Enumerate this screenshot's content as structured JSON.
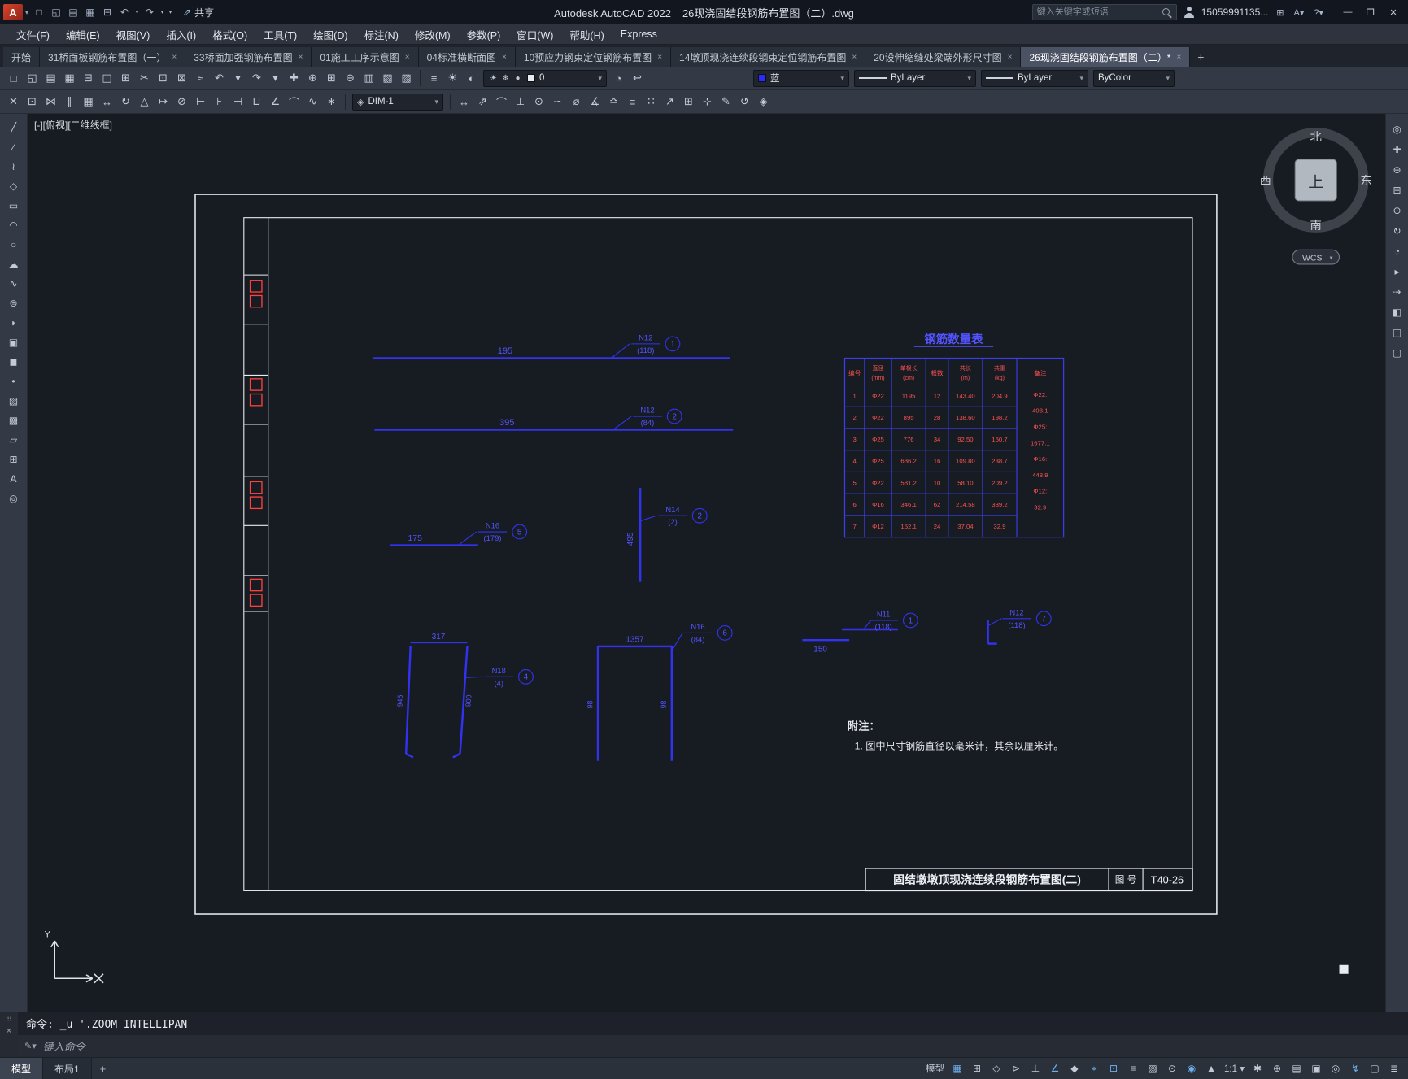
{
  "titlebar": {
    "product": "Autodesk AutoCAD 2022",
    "filename": "26现浇固结段钢筋布置图（二）.dwg",
    "share_label": "共享",
    "search_placeholder": "键入关键字或短语",
    "user_id": "15059991135...",
    "window": {
      "minimize": "—",
      "maximize": "❐",
      "close": "✕"
    },
    "qat_icons": [
      {
        "name": "qat-new-icon",
        "glyph": "□"
      },
      {
        "name": "qat-open-icon",
        "glyph": "◱"
      },
      {
        "name": "qat-save-icon",
        "glyph": "▤"
      },
      {
        "name": "qat-saveas-icon",
        "glyph": "▦"
      },
      {
        "name": "qat-plot-icon",
        "glyph": "⊟"
      },
      {
        "name": "qat-undo-icon",
        "glyph": "↶"
      },
      {
        "name": "qat-undo-arrow-icon",
        "glyph": "▾",
        "small": true
      },
      {
        "name": "qat-redo-icon",
        "glyph": "↷"
      },
      {
        "name": "qat-redo-arrow-icon",
        "glyph": "▾",
        "small": true
      },
      {
        "name": "qat-customize-icon",
        "glyph": "▾",
        "small": true
      }
    ]
  },
  "menubar": {
    "items": [
      {
        "label": "文件(F)"
      },
      {
        "label": "编辑(E)"
      },
      {
        "label": "视图(V)"
      },
      {
        "label": "插入(I)"
      },
      {
        "label": "格式(O)"
      },
      {
        "label": "工具(T)"
      },
      {
        "label": "绘图(D)"
      },
      {
        "label": "标注(N)"
      },
      {
        "label": "修改(M)"
      },
      {
        "label": "参数(P)"
      },
      {
        "label": "窗口(W)"
      },
      {
        "label": "帮助(H)"
      },
      {
        "label": "Express"
      }
    ]
  },
  "tabs": {
    "items": [
      {
        "label": "开始",
        "closable": false,
        "active": false
      },
      {
        "label": "31桥面板钢筋布置图（一）",
        "closable": true,
        "active": false
      },
      {
        "label": "33桥面加强钢筋布置图",
        "closable": true,
        "active": false
      },
      {
        "label": "01施工工序示意图",
        "closable": true,
        "active": false
      },
      {
        "label": "04标准横断面图",
        "closable": true,
        "active": false
      },
      {
        "label": "10预应力钢束定位钢筋布置图",
        "closable": true,
        "active": false
      },
      {
        "label": "14墩顶现浇连续段钢束定位钢筋布置图",
        "closable": true,
        "active": false
      },
      {
        "label": "20设伸缩缝处梁端外形尺寸图",
        "closable": true,
        "active": false
      },
      {
        "label": "26现浇固结段钢筋布置图（二）*",
        "closable": true,
        "active": true
      }
    ],
    "new_tab_label": "+"
  },
  "toolbar1": {
    "icons": [
      {
        "name": "qnew-icon",
        "glyph": "□"
      },
      {
        "name": "open-icon",
        "glyph": "◱"
      },
      {
        "name": "save-icon",
        "glyph": "▤"
      },
      {
        "name": "saveas-icon",
        "glyph": "▦"
      },
      {
        "name": "plot-icon",
        "glyph": "⊟"
      },
      {
        "name": "plot-preview-icon",
        "glyph": "◫"
      },
      {
        "name": "publish-icon",
        "glyph": "⊞"
      },
      {
        "name": "cut-icon",
        "glyph": "✂"
      },
      {
        "name": "copy-clip-icon",
        "glyph": "⊡"
      },
      {
        "name": "paste-icon",
        "glyph": "⊠"
      },
      {
        "name": "match-properties-icon",
        "glyph": "≈"
      },
      {
        "name": "undo-icon",
        "glyph": "↶"
      },
      {
        "name": "undo-list-icon",
        "glyph": "▾",
        "small": true
      },
      {
        "name": "redo-icon",
        "glyph": "↷"
      },
      {
        "name": "redo-list-icon",
        "glyph": "▾",
        "small": true
      },
      {
        "name": "pan-icon",
        "glyph": "✚"
      },
      {
        "name": "zoom-realtime-icon",
        "glyph": "⊕"
      },
      {
        "name": "zoom-window-icon",
        "glyph": "⊞"
      },
      {
        "name": "zoom-previous-icon",
        "glyph": "⊖"
      },
      {
        "name": "properties-icon",
        "glyph": "▥"
      },
      {
        "name": "designcenter-icon",
        "glyph": "▧"
      },
      {
        "name": "tool-palettes-icon",
        "glyph": "▨"
      }
    ],
    "layer_group_icons": [
      {
        "name": "layer-properties-icon",
        "glyph": "≡"
      },
      {
        "name": "layer-states-icon",
        "glyph": "☀"
      },
      {
        "name": "layer-isolate-icon",
        "glyph": "◐"
      }
    ],
    "layer_dropdown": {
      "value": "0",
      "icons": [
        {
          "name": "layer-on-icon",
          "glyph": "☀"
        },
        {
          "name": "layer-freeze-icon",
          "glyph": "❄"
        },
        {
          "name": "layer-lock-icon",
          "glyph": "●"
        }
      ]
    },
    "layer_extra_icons": [
      {
        "name": "make-current-layer-icon",
        "glyph": "◔"
      },
      {
        "name": "layer-previous-icon",
        "glyph": "↩"
      }
    ],
    "color_dropdown": {
      "value": "蓝"
    },
    "linetype_dropdown": {
      "value": "ByLayer"
    },
    "lineweight_dropdown": {
      "value": "ByLayer"
    },
    "plotstyle_dropdown": {
      "value": "ByColor"
    }
  },
  "toolbar2": {
    "icons_left": [
      {
        "name": "erase-icon",
        "glyph": "✕"
      },
      {
        "name": "copy-icon",
        "glyph": "⊡"
      },
      {
        "name": "mirror-icon",
        "glyph": "⋈"
      },
      {
        "name": "offset-icon",
        "glyph": "∥"
      },
      {
        "name": "array-icon",
        "glyph": "▦"
      },
      {
        "name": "move-icon",
        "glyph": "↔"
      },
      {
        "name": "rotate-icon",
        "glyph": "↻"
      },
      {
        "name": "scale-icon",
        "glyph": "△"
      },
      {
        "name": "stretch-icon",
        "glyph": "↦"
      },
      {
        "name": "trim-icon",
        "glyph": "⊘"
      },
      {
        "name": "extend-icon",
        "glyph": "⊢"
      },
      {
        "name": "break-at-point-icon",
        "glyph": "⊦"
      },
      {
        "name": "break-icon",
        "glyph": "⊣"
      },
      {
        "name": "join-icon",
        "glyph": "⊔"
      },
      {
        "name": "chamfer-icon",
        "glyph": "∠"
      },
      {
        "name": "fillet-icon",
        "glyph": "⌒"
      },
      {
        "name": "blend-icon",
        "glyph": "∿"
      },
      {
        "name": "explode-icon",
        "glyph": "∗"
      }
    ],
    "dimstyle_dropdown": {
      "value": "DIM-1"
    },
    "icons_right": [
      {
        "name": "linear-dimension-icon",
        "glyph": "↔"
      },
      {
        "name": "aligned-dimension-icon",
        "glyph": "⇗"
      },
      {
        "name": "arc-length-icon",
        "glyph": "⌒"
      },
      {
        "name": "ordinate-icon",
        "glyph": "⊥"
      },
      {
        "name": "radius-dimension-icon",
        "glyph": "⊙"
      },
      {
        "name": "jogged-icon",
        "glyph": "∽"
      },
      {
        "name": "diameter-dimension-icon",
        "glyph": "⌀"
      },
      {
        "name": "angular-dimension-icon",
        "glyph": "∡"
      },
      {
        "name": "quick-dimension-icon",
        "glyph": "≏"
      },
      {
        "name": "baseline-dimension-icon",
        "glyph": "≡"
      },
      {
        "name": "continue-dimension-icon",
        "glyph": "∷"
      },
      {
        "name": "leader-icon",
        "glyph": "↗"
      },
      {
        "name": "tolerance-icon",
        "glyph": "⊞"
      },
      {
        "name": "center-mark-icon",
        "glyph": "⊹"
      },
      {
        "name": "dimension-edit-icon",
        "glyph": "✎"
      },
      {
        "name": "dimension-update-icon",
        "glyph": "↺"
      },
      {
        "name": "dimension-style-icon",
        "glyph": "◈"
      }
    ]
  },
  "left_toolbar": {
    "icons": [
      {
        "name": "line-icon",
        "glyph": "╱"
      },
      {
        "name": "construction-line-icon",
        "glyph": "∕"
      },
      {
        "name": "polyline-icon",
        "glyph": "≀"
      },
      {
        "name": "polygon-icon",
        "glyph": "◇"
      },
      {
        "name": "rectangle-icon",
        "glyph": "▭"
      },
      {
        "name": "arc-icon",
        "glyph": "◠"
      },
      {
        "name": "circle-icon",
        "glyph": "○"
      },
      {
        "name": "revision-cloud-icon",
        "glyph": "☁"
      },
      {
        "name": "spline-icon",
        "glyph": "∿"
      },
      {
        "name": "ellipse-icon",
        "glyph": "⊜"
      },
      {
        "name": "ellipse-arc-icon",
        "glyph": "◗"
      },
      {
        "name": "insert-block-icon",
        "glyph": "▣"
      },
      {
        "name": "make-block-icon",
        "glyph": "◼"
      },
      {
        "name": "point-icon",
        "glyph": "•"
      },
      {
        "name": "hatch-icon",
        "glyph": "▨"
      },
      {
        "name": "gradient-icon",
        "glyph": "▩"
      },
      {
        "name": "region-icon",
        "glyph": "▱"
      },
      {
        "name": "table-icon",
        "glyph": "⊞"
      },
      {
        "name": "multiline-text-icon",
        "glyph": "A"
      },
      {
        "name": "add-selected-icon",
        "glyph": "◎"
      }
    ]
  },
  "right_toolbar": {
    "icons": [
      {
        "name": "navigation-wheel-icon",
        "glyph": "◎"
      },
      {
        "name": "pan-icon",
        "glyph": "✚"
      },
      {
        "name": "zoom-extents-icon",
        "glyph": "⊕"
      },
      {
        "name": "zoom-window-icon",
        "glyph": "⊞"
      },
      {
        "name": "zoom-realtime-icon",
        "glyph": "⊙"
      },
      {
        "name": "orbit-icon",
        "glyph": "↻"
      },
      {
        "name": "free-orbit-icon",
        "glyph": "◔"
      },
      {
        "name": "showmotion-icon",
        "glyph": "▸"
      },
      {
        "name": "measure-icon",
        "glyph": "⇢"
      },
      {
        "name": "section-icon",
        "glyph": "◧"
      },
      {
        "name": "camera-icon",
        "glyph": "◫"
      },
      {
        "name": "display-icon",
        "glyph": "▢"
      }
    ]
  },
  "canvas": {
    "viewport_label": "[-][俯视][二维线框]",
    "viewcube": {
      "north": "北",
      "south": "南",
      "west": "西",
      "east": "东",
      "top": "上",
      "wcs": "WCS"
    },
    "ucs": {
      "y_label": "Y"
    },
    "table": {
      "title": "钢筋数量表",
      "headers": [
        "编号",
        "直径(mm)",
        "单根长(cm)",
        "根数",
        "共长(m)",
        "共重(kg)",
        "备注"
      ],
      "rows": [
        [
          "1",
          "Φ22",
          "1195",
          "12",
          "143.40",
          "204.9"
        ],
        [
          "2",
          "Φ22",
          "895",
          "28",
          "138.60",
          "198.2"
        ],
        [
          "3",
          "Φ25",
          "776",
          "34",
          "92.50",
          "150.7"
        ],
        [
          "4",
          "Φ25",
          "686.2",
          "16",
          "109.80",
          "238.7"
        ],
        [
          "5",
          "Φ22",
          "581.2",
          "10",
          "58.10",
          "209.2"
        ],
        [
          "6",
          "Φ16",
          "346.1",
          "62",
          "214.58",
          "339.2"
        ],
        [
          "7",
          "Φ12",
          "152.1",
          "24",
          "37.04",
          "32.9"
        ]
      ],
      "remark_lines": [
        "Φ22:",
        "403.1",
        "Φ25:",
        "1677.1",
        "Φ16:",
        "448.9",
        "Φ12:",
        "32.9"
      ]
    },
    "bars": [
      {
        "dim": "195",
        "mark": "N12",
        "count": "(118)",
        "num": "1"
      },
      {
        "dim": "395",
        "mark": "N12",
        "count": "(84)",
        "num": "2"
      },
      {
        "dim": "175",
        "mark": "N16",
        "count": "(179)",
        "num": "5"
      },
      {
        "dim": "495",
        "mark": "N14",
        "count": "(2)",
        "num": "2"
      },
      {
        "dim": "317",
        "side1": "945",
        "side2": "900",
        "mark": "N18",
        "count": "(4)",
        "num": "4"
      },
      {
        "dim": "1357",
        "side1": "98",
        "side2": "98",
        "mark": "N16",
        "count": "(84)",
        "num": "6"
      },
      {
        "dim": "150",
        "mark": "N11",
        "count": "(118)",
        "num": "1"
      },
      {
        "mark": "N12",
        "count": "(118)",
        "num": "7"
      }
    ],
    "notes": {
      "title": "附注：",
      "line1": "1. 图中尺寸钢筋直径以毫米计，其余以厘米计。"
    },
    "titleblock": {
      "name": "固结墩墩顶现浇连续段钢筋布置图(二)",
      "no_label": "图 号",
      "no_value": "T40-26"
    }
  },
  "command": {
    "line1": "命令: _u '.ZOOM INTELLIPAN",
    "prompt": "键入命令"
  },
  "statusbar": {
    "left_tabs": [
      {
        "label": "模型",
        "active": true
      },
      {
        "label": "布局1",
        "active": false
      }
    ],
    "new_layout_label": "+",
    "icons": [
      {
        "name": "model-paper-toggle",
        "label": "模型"
      },
      {
        "name": "grid-display-icon",
        "glyph": "▦",
        "active": true
      },
      {
        "name": "snap-mode-icon",
        "glyph": "⊞"
      },
      {
        "name": "infer-constraints-icon",
        "glyph": "◇"
      },
      {
        "name": "dynamic-input-icon",
        "glyph": "⊳"
      },
      {
        "name": "ortho-mode-icon",
        "glyph": "⊥"
      },
      {
        "name": "polar-tracking-icon",
        "glyph": "∠",
        "active": true
      },
      {
        "name": "isodraft-icon",
        "glyph": "◆"
      },
      {
        "name": "object-snap-tracking-icon",
        "glyph": "⌖",
        "active": true
      },
      {
        "name": "object-snap-icon",
        "glyph": "⊡",
        "active": true
      },
      {
        "name": "lineweight-icon",
        "glyph": "≡"
      },
      {
        "name": "transparency-icon",
        "glyph": "▨"
      },
      {
        "name": "selection-cycling-icon",
        "glyph": "⊙"
      },
      {
        "name": "annotation-visibility-icon",
        "glyph": "◉",
        "active": true
      },
      {
        "name": "annotation-autoscale-icon",
        "glyph": "▲"
      },
      {
        "name": "annotation-scale-button",
        "label": "1:1 ▾"
      },
      {
        "name": "workspace-switching-icon",
        "glyph": "✱"
      },
      {
        "name": "annotation-monitor-icon",
        "glyph": "⊕"
      },
      {
        "name": "quick-properties-icon",
        "glyph": "▤"
      },
      {
        "name": "lock-ui-icon",
        "glyph": "▣"
      },
      {
        "name": "isolate-objects-icon",
        "glyph": "◎"
      },
      {
        "name": "graphics-performance-icon",
        "glyph": "↯",
        "active": true
      },
      {
        "name": "clean-screen-icon",
        "glyph": "▢"
      },
      {
        "name": "customization-icon",
        "glyph": "≣"
      }
    ]
  }
}
